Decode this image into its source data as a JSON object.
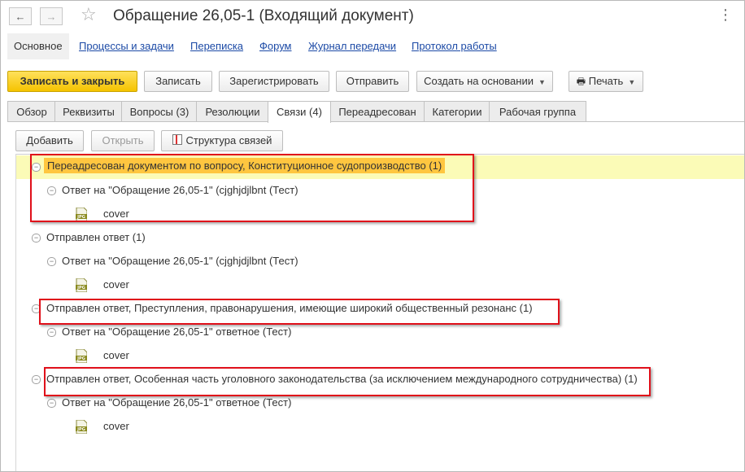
{
  "window": {
    "title": "Обращение 26,05-1 (Входящий документ)",
    "icons": {
      "back": "arrow-left-icon",
      "forward": "arrow-right-icon",
      "favorite": "star-icon",
      "menu": "more-vertical-icon"
    }
  },
  "top_tabs": [
    {
      "label": "Основное"
    },
    {
      "label": "Процессы и задачи"
    },
    {
      "label": "Переписка"
    },
    {
      "label": "Форум"
    },
    {
      "label": "Журнал передачи"
    },
    {
      "label": "Протокол работы"
    }
  ],
  "toolbar": {
    "save_close": "Записать и закрыть",
    "save": "Записать",
    "register": "Зарегистрировать",
    "send": "Отправить",
    "create_based": "Создать на основании",
    "print": "Печать"
  },
  "tabs": [
    {
      "label": "Обзор"
    },
    {
      "label": "Реквизиты"
    },
    {
      "label": "Вопросы (3)"
    },
    {
      "label": "Резолюции"
    },
    {
      "label": "Связи (4)"
    },
    {
      "label": "Переадресован"
    },
    {
      "label": "Категории"
    },
    {
      "label": "Рабочая группа"
    }
  ],
  "links_toolbar": {
    "add": "Добавить",
    "open": "Открыть",
    "structure": "Структура связей"
  },
  "tree": [
    {
      "text": "Переадресован документом по вопросу, Конституционное судопроизводство (1)"
    },
    {
      "text": "Ответ на \"Обращение 26,05-1\" (cjghjdjlbnt (Тест)"
    },
    {
      "text": "cover",
      "icon": "jpg-file-icon"
    },
    {
      "text": "Отправлен ответ (1)"
    },
    {
      "text": "Ответ на \"Обращение 26,05-1\" (cjghjdjlbnt (Тест)"
    },
    {
      "text": "cover",
      "icon": "jpg-file-icon"
    },
    {
      "text": "Отправлен ответ, Преступления, правонарушения, имеющие широкий общественный резонанс (1)"
    },
    {
      "text": "Ответ на \"Обращение 26,05-1\" ответное (Тест)"
    },
    {
      "text": "cover",
      "icon": "jpg-file-icon"
    },
    {
      "text": "Отправлен ответ, Особенная часть уголовного законодательства (за исключением международного сотрудничества) (1)"
    },
    {
      "text": "Ответ на \"Обращение 26,05-1\" ответное (Тест)"
    },
    {
      "text": "cover",
      "icon": "jpg-file-icon"
    }
  ],
  "colors": {
    "primary_button": "#f5c300",
    "selected_row": "#fbfbb7",
    "highlight": "#ffc640",
    "annotation_box": "#e0101a",
    "link": "#1c4aa6"
  }
}
